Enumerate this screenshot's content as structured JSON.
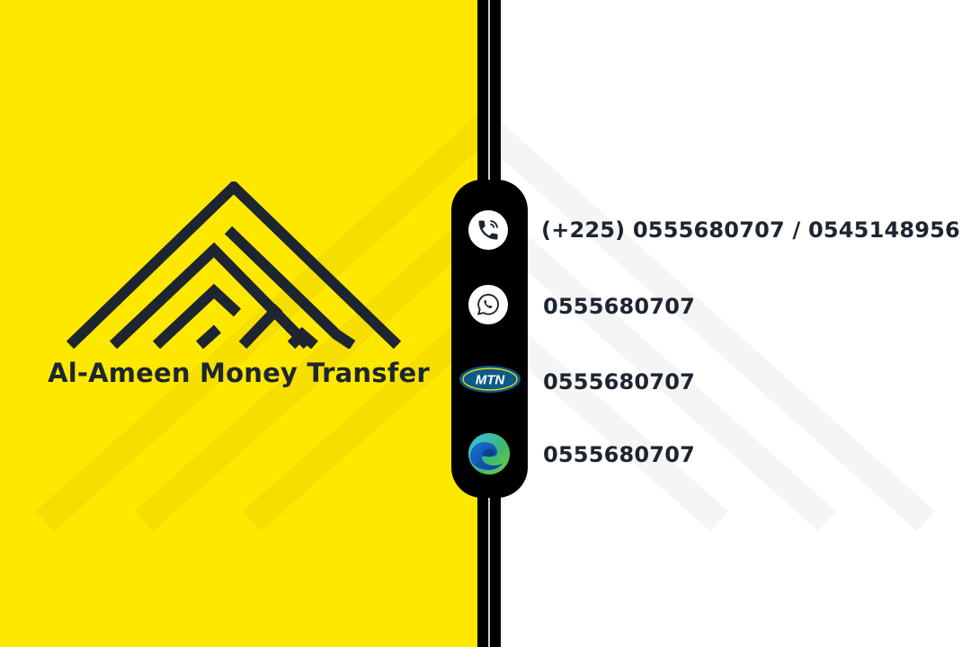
{
  "brand": {
    "company_name": "Al-Ameen Money Transfer",
    "colors": {
      "background_left": "#ffe800",
      "text": "#1d2530",
      "divider": "#000000"
    }
  },
  "contacts": [
    {
      "icon": "phone-icon",
      "value": "(+225) 0555680707 / 0545148956"
    },
    {
      "icon": "whatsapp-icon",
      "value": "0555680707"
    },
    {
      "icon": "mtn-logo",
      "value": "0555680707",
      "badge_text": "MTN"
    },
    {
      "icon": "edge-browser-icon",
      "value": "0555680707"
    }
  ]
}
